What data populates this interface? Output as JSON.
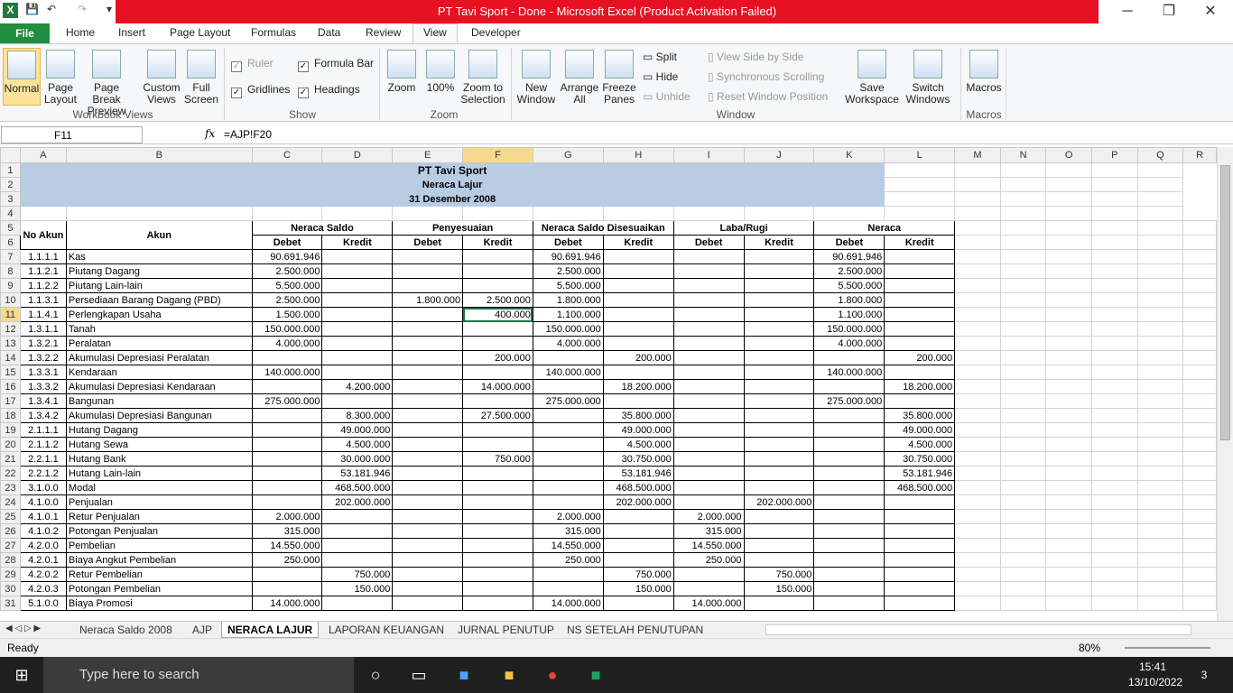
{
  "window": {
    "title": "PT Tavi Sport - Done - Microsoft Excel (Product Activation Failed)",
    "minimize": "─",
    "restore": "❐",
    "close": "✕"
  },
  "qat": {
    "logo": "X",
    "save": "💾",
    "undo": "↶",
    "redo": "↷",
    "more": "▾"
  },
  "tabs": {
    "file": "File",
    "home": "Home",
    "insert": "Insert",
    "page_layout": "Page Layout",
    "formulas": "Formulas",
    "data": "Data",
    "review": "Review",
    "view": "View",
    "developer": "Developer"
  },
  "ribbon": {
    "normal": "Normal",
    "page_layout": "Page Layout",
    "page_break": "Page Break Preview",
    "custom_views": "Custom Views",
    "full_screen": "Full Screen",
    "workbook_views": "Workbook Views",
    "ruler": "Ruler",
    "formula_bar": "Formula Bar",
    "gridlines": "Gridlines",
    "headings": "Headings",
    "show": "Show",
    "zoom": "Zoom",
    "zoom100": "100%",
    "zoom_sel": "Zoom to Selection",
    "zoom_group": "Zoom",
    "new_window": "New Window",
    "arrange_all": "Arrange All",
    "freeze": "Freeze Panes",
    "split": "Split",
    "hide": "Hide",
    "unhide": "Unhide",
    "side_by_side": "View Side by Side",
    "sync_scroll": "Synchronous Scrolling",
    "reset_pos": "Reset Window Position",
    "window_group": "Window",
    "save_ws": "Save Workspace",
    "switch_win": "Switch Windows",
    "macros": "Macros",
    "macros_group": "Macros"
  },
  "formula_bar": {
    "name": "F11",
    "fx": "fx",
    "formula": "=AJP!F20"
  },
  "columns": [
    "A",
    "B",
    "C",
    "D",
    "E",
    "F",
    "G",
    "H",
    "I",
    "J",
    "K",
    "L",
    "M",
    "N",
    "O",
    "P",
    "Q",
    "R"
  ],
  "header": {
    "company": "PT Tavi Sport",
    "title": "Neraca Lajur",
    "date": "31 Desember 2008",
    "no_akun": "No Akun",
    "akun": "Akun",
    "neraca_saldo": "Neraca Saldo",
    "penyesuaian": "Penyesuaian",
    "nsd": "Neraca Saldo Disesuaikan",
    "laba_rugi": "Laba/Rugi",
    "neraca": "Neraca",
    "debet": "Debet",
    "kredit": "Kredit"
  },
  "rows": [
    {
      "r": "7",
      "a": "1.1.1.1",
      "b": "Kas",
      "c": "90.691.946",
      "d": "",
      "e": "",
      "f": "",
      "g": "90.691.946",
      "h": "",
      "i": "",
      "j": "",
      "k": "90.691.946",
      "l": ""
    },
    {
      "r": "8",
      "a": "1.1.2.1",
      "b": "Piutang Dagang",
      "c": "2.500.000",
      "d": "",
      "e": "",
      "f": "",
      "g": "2.500.000",
      "h": "",
      "i": "",
      "j": "",
      "k": "2.500.000",
      "l": ""
    },
    {
      "r": "9",
      "a": "1.1.2.2",
      "b": "Piutang Lain-lain",
      "c": "5.500.000",
      "d": "",
      "e": "",
      "f": "",
      "g": "5.500.000",
      "h": "",
      "i": "",
      "j": "",
      "k": "5.500.000",
      "l": ""
    },
    {
      "r": "10",
      "a": "1.1.3.1",
      "b": "Persediaan Barang Dagang (PBD)",
      "c": "2.500.000",
      "d": "",
      "e": "1.800.000",
      "f": "2.500.000",
      "g": "1.800.000",
      "h": "",
      "i": "",
      "j": "",
      "k": "1.800.000",
      "l": ""
    },
    {
      "r": "11",
      "a": "1.1.4.1",
      "b": "Perlengkapan Usaha",
      "c": "1.500.000",
      "d": "",
      "e": "",
      "f": "400.000",
      "g": "1.100.000",
      "h": "",
      "i": "",
      "j": "",
      "k": "1.100.000",
      "l": ""
    },
    {
      "r": "12",
      "a": "1.3.1.1",
      "b": "Tanah",
      "c": "150.000.000",
      "d": "",
      "e": "",
      "f": "",
      "g": "150.000.000",
      "h": "",
      "i": "",
      "j": "",
      "k": "150.000.000",
      "l": ""
    },
    {
      "r": "13",
      "a": "1.3.2.1",
      "b": "Peralatan",
      "c": "4.000.000",
      "d": "",
      "e": "",
      "f": "",
      "g": "4.000.000",
      "h": "",
      "i": "",
      "j": "",
      "k": "4.000.000",
      "l": ""
    },
    {
      "r": "14",
      "a": "1.3.2.2",
      "b": "Akumulasi Depresiasi Peralatan",
      "c": "",
      "d": "",
      "e": "",
      "f": "200.000",
      "g": "",
      "h": "200.000",
      "i": "",
      "j": "",
      "k": "",
      "l": "200.000"
    },
    {
      "r": "15",
      "a": "1.3.3.1",
      "b": "Kendaraan",
      "c": "140.000.000",
      "d": "",
      "e": "",
      "f": "",
      "g": "140.000.000",
      "h": "",
      "i": "",
      "j": "",
      "k": "140.000.000",
      "l": ""
    },
    {
      "r": "16",
      "a": "1.3.3.2",
      "b": "Akumulasi Depresiasi Kendaraan",
      "c": "",
      "d": "4.200.000",
      "e": "",
      "f": "14.000.000",
      "g": "",
      "h": "18.200.000",
      "i": "",
      "j": "",
      "k": "",
      "l": "18.200.000"
    },
    {
      "r": "17",
      "a": "1.3.4.1",
      "b": "Bangunan",
      "c": "275.000.000",
      "d": "",
      "e": "",
      "f": "",
      "g": "275.000.000",
      "h": "",
      "i": "",
      "j": "",
      "k": "275.000.000",
      "l": ""
    },
    {
      "r": "18",
      "a": "1.3.4.2",
      "b": "Akumulasi Depresiasi Bangunan",
      "c": "",
      "d": "8.300.000",
      "e": "",
      "f": "27.500.000",
      "g": "",
      "h": "35.800.000",
      "i": "",
      "j": "",
      "k": "",
      "l": "35.800.000"
    },
    {
      "r": "19",
      "a": "2.1.1.1",
      "b": "Hutang Dagang",
      "c": "",
      "d": "49.000.000",
      "e": "",
      "f": "",
      "g": "",
      "h": "49.000.000",
      "i": "",
      "j": "",
      "k": "",
      "l": "49.000.000"
    },
    {
      "r": "20",
      "a": "2.1.1.2",
      "b": "Hutang Sewa",
      "c": "",
      "d": "4.500.000",
      "e": "",
      "f": "",
      "g": "",
      "h": "4.500.000",
      "i": "",
      "j": "",
      "k": "",
      "l": "4.500.000"
    },
    {
      "r": "21",
      "a": "2.2.1.1",
      "b": "Hutang Bank",
      "c": "",
      "d": "30.000.000",
      "e": "",
      "f": "750.000",
      "g": "",
      "h": "30.750.000",
      "i": "",
      "j": "",
      "k": "",
      "l": "30.750.000"
    },
    {
      "r": "22",
      "a": "2.2.1.2",
      "b": "Hutang Lain-lain",
      "c": "",
      "d": "53.181.946",
      "e": "",
      "f": "",
      "g": "",
      "h": "53.181.946",
      "i": "",
      "j": "",
      "k": "",
      "l": "53.181.946"
    },
    {
      "r": "23",
      "a": "3.1.0.0",
      "b": "Modal",
      "c": "",
      "d": "468.500.000",
      "e": "",
      "f": "",
      "g": "",
      "h": "468.500.000",
      "i": "",
      "j": "",
      "k": "",
      "l": "468.500.000"
    },
    {
      "r": "24",
      "a": "4.1.0.0",
      "b": "Penjualan",
      "c": "",
      "d": "202.000.000",
      "e": "",
      "f": "",
      "g": "",
      "h": "202.000.000",
      "i": "",
      "j": "202.000.000",
      "k": "",
      "l": ""
    },
    {
      "r": "25",
      "a": "4.1.0.1",
      "b": "Retur Penjualan",
      "c": "2.000.000",
      "d": "",
      "e": "",
      "f": "",
      "g": "2.000.000",
      "h": "",
      "i": "2.000.000",
      "j": "",
      "k": "",
      "l": ""
    },
    {
      "r": "26",
      "a": "4.1.0.2",
      "b": "Potongan Penjualan",
      "c": "315.000",
      "d": "",
      "e": "",
      "f": "",
      "g": "315.000",
      "h": "",
      "i": "315.000",
      "j": "",
      "k": "",
      "l": ""
    },
    {
      "r": "27",
      "a": "4.2.0.0",
      "b": "Pembelian",
      "c": "14.550.000",
      "d": "",
      "e": "",
      "f": "",
      "g": "14.550.000",
      "h": "",
      "i": "14.550.000",
      "j": "",
      "k": "",
      "l": ""
    },
    {
      "r": "28",
      "a": "4.2.0.1",
      "b": "Biaya Angkut Pembelian",
      "c": "250.000",
      "d": "",
      "e": "",
      "f": "",
      "g": "250.000",
      "h": "",
      "i": "250.000",
      "j": "",
      "k": "",
      "l": ""
    },
    {
      "r": "29",
      "a": "4.2.0.2",
      "b": "Retur Pembelian",
      "c": "",
      "d": "750.000",
      "e": "",
      "f": "",
      "g": "",
      "h": "750.000",
      "i": "",
      "j": "750.000",
      "k": "",
      "l": ""
    },
    {
      "r": "30",
      "a": "4.2.0.3",
      "b": "Potongan Pembelian",
      "c": "",
      "d": "150.000",
      "e": "",
      "f": "",
      "g": "",
      "h": "150.000",
      "i": "",
      "j": "150.000",
      "k": "",
      "l": ""
    },
    {
      "r": "31",
      "a": "5.1.0.0",
      "b": "Biaya Promosi",
      "c": "14.000.000",
      "d": "",
      "e": "",
      "f": "",
      "g": "14.000.000",
      "h": "",
      "i": "14.000.000",
      "j": "",
      "k": "",
      "l": ""
    }
  ],
  "sheet_tabs": [
    "Neraca Saldo 2008",
    "AJP",
    "NERACA LAJUR",
    "LAPORAN KEUANGAN",
    "JURNAL PENUTUP",
    "NS SETELAH PENUTUPAN"
  ],
  "status": {
    "ready": "Ready",
    "zoom": "80%"
  },
  "taskbar": {
    "search": "Type here to search",
    "time": "15:41",
    "date": "13/10/2022",
    "notif": "3"
  }
}
